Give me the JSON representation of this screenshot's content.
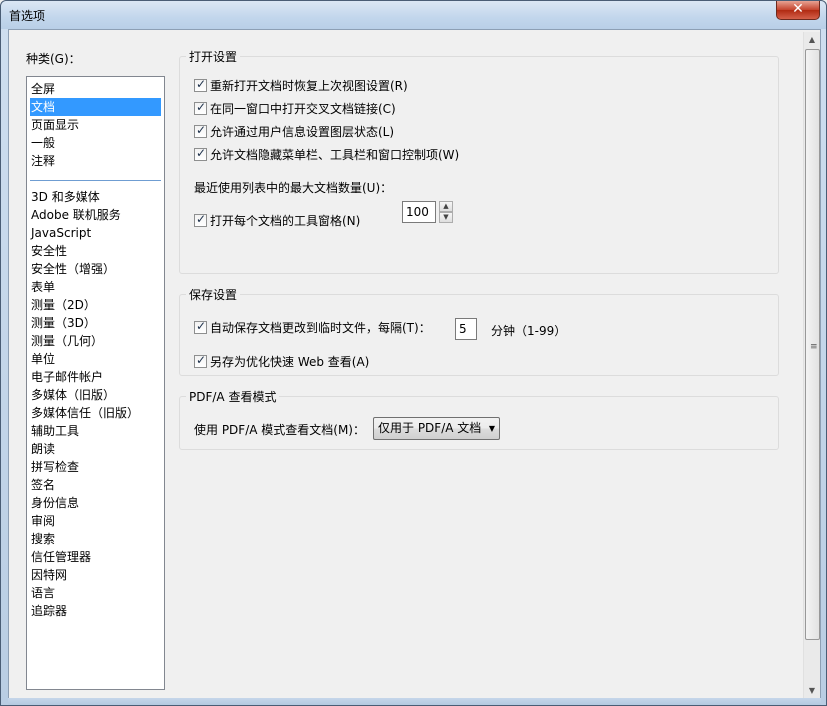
{
  "window": {
    "title": "首选项",
    "close_glyph": "✕"
  },
  "categories": {
    "label": "种类(G)：",
    "group1": [
      "全屏",
      "文档",
      "页面显示",
      "一般",
      "注释"
    ],
    "selected": "文档",
    "group2": [
      "3D 和多媒体",
      "Adobe 联机服务",
      "JavaScript",
      "安全性",
      "安全性（增强）",
      "表单",
      "测量（2D）",
      "测量（3D）",
      "测量（几何）",
      "单位",
      "电子邮件帐户",
      "多媒体（旧版）",
      "多媒体信任（旧版）",
      "辅助工具",
      "朗读",
      "拼写检查",
      "签名",
      "身份信息",
      "审阅",
      "搜索",
      "信任管理器",
      "因特网",
      "语言",
      "追踪器"
    ]
  },
  "open_settings": {
    "title": "打开设置",
    "restore_view": "重新打开文档时恢复上次视图设置(R)",
    "open_cross_links": "在同一窗口中打开交叉文档链接(C)",
    "allow_layer_state": "允许通过用户信息设置图层状态(L)",
    "allow_hide_bars": "允许文档隐藏菜单栏、工具栏和窗口控制项(W)",
    "max_recent_label": "最近使用列表中的最大文档数量(U)：",
    "max_recent_value": "100",
    "open_tools_pane": "打开每个文档的工具窗格(N)"
  },
  "save_settings": {
    "title": "保存设置",
    "autosave_label": "自动保存文档更改到临时文件，每隔(T)：",
    "autosave_value": "5",
    "autosave_unit": "分钟（1-99）",
    "save_optimized": "另存为优化快速 Web 查看(A)"
  },
  "pdfa": {
    "title": "PDF/A 查看模式",
    "mode_label": "使用 PDF/A 模式查看文档(M)：",
    "mode_value": "仅用于 PDF/A 文档"
  },
  "scrollbar": {
    "grip_glyph": "≡",
    "up_glyph": "▲",
    "down_glyph": "▼"
  }
}
